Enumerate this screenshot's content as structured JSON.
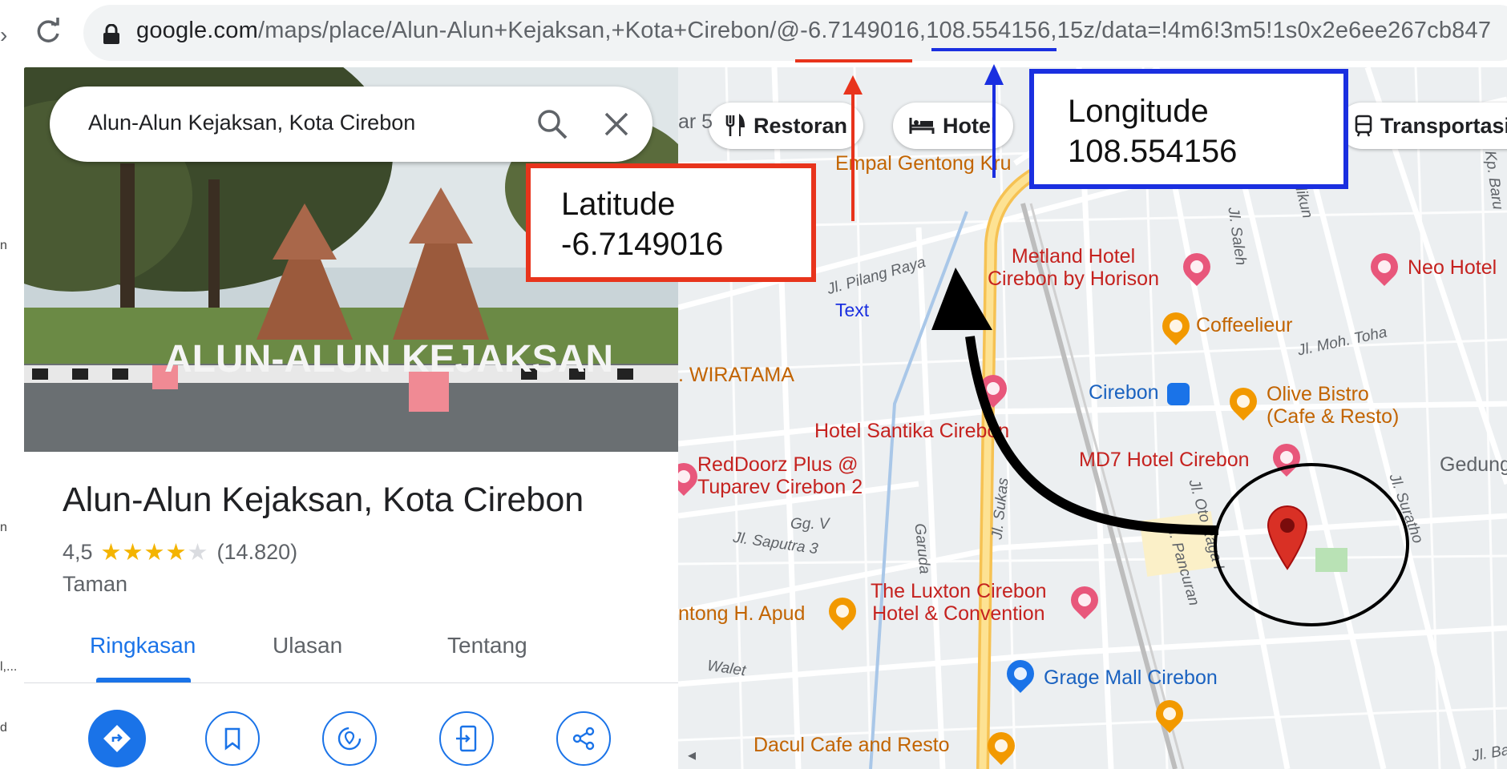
{
  "browser": {
    "url_host": "google.com",
    "url_path": "/maps/place/Alun-Alun+Kejaksan,+Kota+Cirebon/@",
    "url_lat": "-6.7149016",
    "url_sep": ",",
    "url_lon": "108.554156",
    "url_rest": ",15z/data=!4m6!3m5!1s0x2e6ee267cb847"
  },
  "left_strip": [
    "n",
    "n",
    "n",
    "l,...",
    "d"
  ],
  "panel": {
    "search_value": "Alun-Alun Kejaksan, Kota Cirebon",
    "photo_sign": "ALUN-ALUN KEJAKSAN",
    "title": "Alun-Alun Kejaksan, Kota Cirebon",
    "rating": "4,5",
    "reviews": "(14.820)",
    "category": "Taman",
    "tabs": [
      {
        "label": "Ringkasan"
      },
      {
        "label": "Ulasan"
      },
      {
        "label": "Tentang"
      }
    ],
    "actions": [
      "directions-icon",
      "bookmark-icon",
      "nearby-icon",
      "send-to-phone-icon",
      "share-icon"
    ]
  },
  "map": {
    "chips": [
      {
        "label": "Restoran"
      },
      {
        "label": "Hotel"
      },
      {
        "label": "Transportasi"
      }
    ],
    "chip_partial": "ar 5",
    "labels": {
      "empal": "Empal Gentong Kru",
      "metland": "Metland Hotel\nCirebon by Horison",
      "neo": "Neo Hotel",
      "coffeelieur": "Coffeelieur",
      "wiratama": ". WIRATAMA",
      "cirebon_station": "Cirebon",
      "olive": "Olive Bistro\n(Cafe & Resto)",
      "santika": "Hotel Santika Cirebon",
      "reddoorz": "RedDoorz Plus @\nTuparev Cirebon 2",
      "md7": "MD7 Hotel Cirebon",
      "gedung": "Gedung",
      "luxton": "The Luxton Cirebon\nHotel & Convention",
      "apud": "ntong H. Apud",
      "grage": "Grage Mall Cirebon",
      "dacul": "Dacul Cafe and Resto",
      "text": "Text"
    },
    "streets": {
      "pilang": "Jl. Pilang Raya",
      "saleh": "Jl. Saleh",
      "tohamoh": "Jl. Moh. Toha",
      "saputra": "Jl. Saputra 3",
      "garuda": "Garuda",
      "sukas": "Jl. Sukas",
      "pancuran": "Jl. Pancuran",
      "oranga": "Jl. Oto Raga I",
      "surathe": "Jl. Suratho",
      "walet": "Walet",
      "gg": "Gg. V",
      "kpbaru": "Kp. Baru",
      "adikun": "adikun",
      "jlba": "Jl. Ba"
    }
  },
  "annotations": {
    "latitude_title": "Latitude",
    "latitude_value": "-6.7149016",
    "longitude_title": "Longitude",
    "longitude_value": "108.554156"
  },
  "colors": {
    "latitude_accent": "#e8341c",
    "longitude_accent": "#1a2fe0",
    "google_blue": "#1a73e8",
    "star_yellow": "#f4b400"
  }
}
